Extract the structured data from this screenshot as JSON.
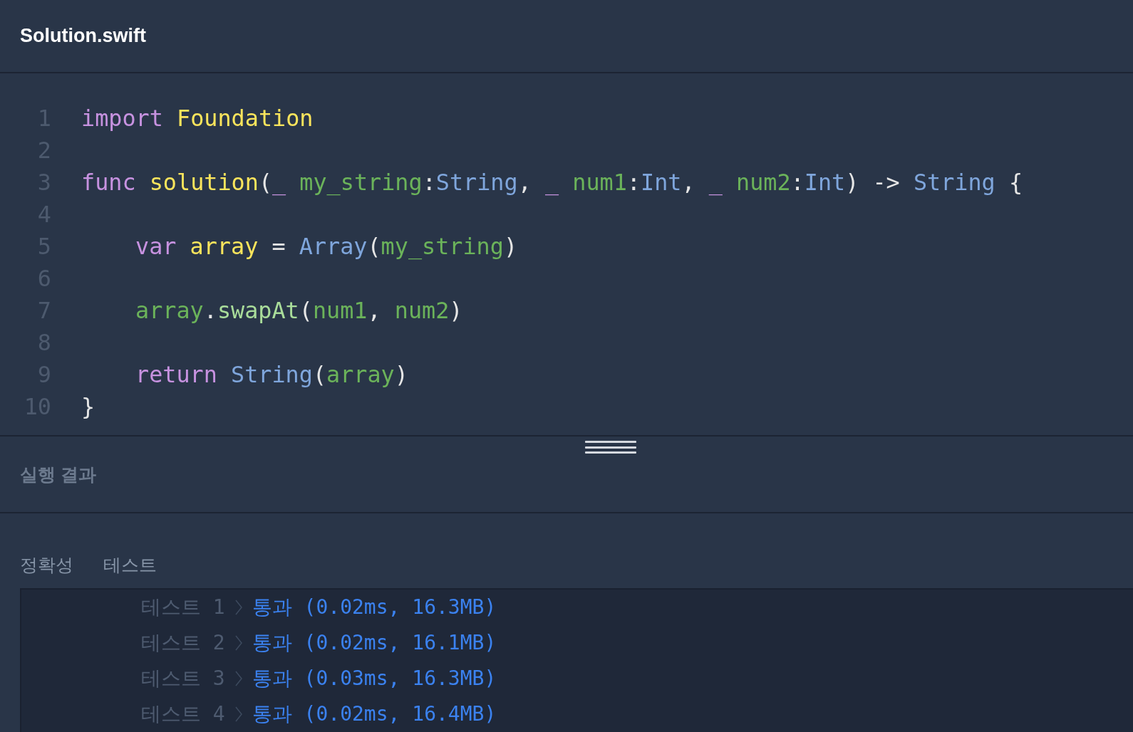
{
  "editor": {
    "filename": "Solution.swift",
    "lines": [
      {
        "number": "1",
        "indented": false,
        "tokens": [
          {
            "kind": "keyword",
            "text": "import "
          },
          {
            "kind": "name",
            "text": "Foundation"
          }
        ]
      },
      {
        "number": "2"
      },
      {
        "number": "3",
        "indented": false,
        "tokens": [
          {
            "kind": "keyword",
            "text": "func "
          },
          {
            "kind": "name",
            "text": "solution"
          },
          {
            "kind": "plain",
            "text": "("
          },
          {
            "kind": "keyword",
            "text": "_ "
          },
          {
            "kind": "param",
            "text": "my_string"
          },
          {
            "kind": "plain",
            "text": ":"
          },
          {
            "kind": "type",
            "text": "String"
          },
          {
            "kind": "plain",
            "text": ", "
          },
          {
            "kind": "keyword",
            "text": "_ "
          },
          {
            "kind": "param",
            "text": "num1"
          },
          {
            "kind": "plain",
            "text": ":"
          },
          {
            "kind": "type",
            "text": "Int"
          },
          {
            "kind": "plain",
            "text": ", "
          },
          {
            "kind": "keyword",
            "text": "_ "
          },
          {
            "kind": "param",
            "text": "num2"
          },
          {
            "kind": "plain",
            "text": ":"
          },
          {
            "kind": "type",
            "text": "Int"
          },
          {
            "kind": "plain",
            "text": ") -> "
          },
          {
            "kind": "type",
            "text": "String"
          },
          {
            "kind": "plain",
            "text": " {"
          }
        ]
      },
      {
        "number": "4"
      },
      {
        "number": "5",
        "indented": true,
        "tokens": [
          {
            "kind": "keyword",
            "text": "var "
          },
          {
            "kind": "name",
            "text": "array"
          },
          {
            "kind": "plain",
            "text": " = "
          },
          {
            "kind": "type",
            "text": "Array"
          },
          {
            "kind": "plain",
            "text": "("
          },
          {
            "kind": "param",
            "text": "my_string"
          },
          {
            "kind": "plain",
            "text": ")"
          }
        ]
      },
      {
        "number": "6"
      },
      {
        "number": "7",
        "indented": true,
        "tokens": [
          {
            "kind": "param",
            "text": "array"
          },
          {
            "kind": "plain",
            "text": "."
          },
          {
            "kind": "method",
            "text": "swapAt"
          },
          {
            "kind": "plain",
            "text": "("
          },
          {
            "kind": "param",
            "text": "num1"
          },
          {
            "kind": "plain",
            "text": ", "
          },
          {
            "kind": "param",
            "text": "num2"
          },
          {
            "kind": "plain",
            "text": ")"
          }
        ]
      },
      {
        "number": "8"
      },
      {
        "number": "9",
        "indented": true,
        "tokens": [
          {
            "kind": "keyword",
            "text": "return "
          },
          {
            "kind": "type",
            "text": "String"
          },
          {
            "kind": "plain",
            "text": "("
          },
          {
            "kind": "param",
            "text": "array"
          },
          {
            "kind": "plain",
            "text": ")"
          }
        ]
      },
      {
        "number": "10",
        "indented": false,
        "tokens": [
          {
            "kind": "plain",
            "text": "}"
          }
        ]
      }
    ]
  },
  "results": {
    "title": "실행 결과",
    "section_title": "정확성  테스트",
    "tests": [
      {
        "label": "테스트 1",
        "result": "통과 (0.02ms, 16.3MB)"
      },
      {
        "label": "테스트 2",
        "result": "통과 (0.02ms, 16.1MB)"
      },
      {
        "label": "테스트 3",
        "result": "통과 (0.03ms, 16.3MB)"
      },
      {
        "label": "테스트 4",
        "result": "통과 (0.02ms, 16.4MB)"
      }
    ]
  }
}
